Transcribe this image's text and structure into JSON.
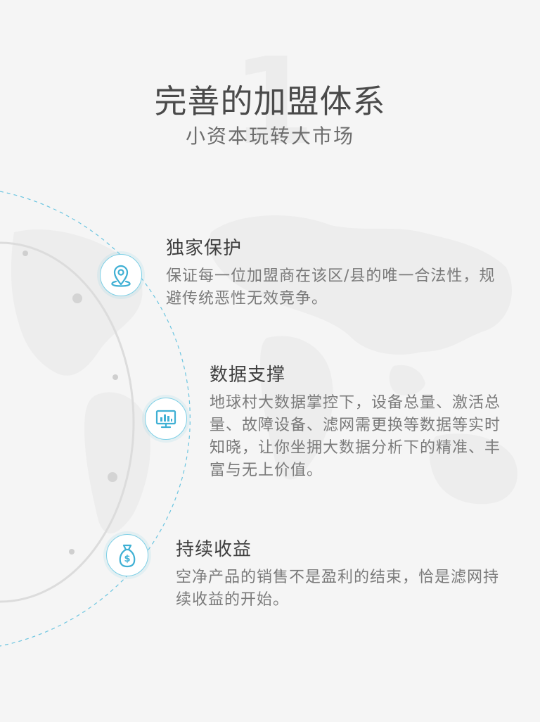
{
  "header": {
    "number": "1",
    "title": "完善的加盟体系",
    "subtitle": "小资本玩转大市场"
  },
  "features": [
    {
      "title": "独家保护",
      "description": "保证每一位加盟商在该区/县的唯一合法性，规避传统恶性无效竞争。",
      "icon": "location-pin-icon"
    },
    {
      "title": "数据支撑",
      "description": "地球村大数据掌控下，设备总量、激活总量、故障设备、滤网需更换等数据等实时知晓，让你坐拥大数据分析下的精准、丰富与无上价值。",
      "icon": "monitor-chart-icon"
    },
    {
      "title": "持续收益",
      "description": "空净产品的销售不是盈利的结束，恰是滤网持续收益的开始。",
      "icon": "money-bag-icon"
    }
  ],
  "colors": {
    "accent": "#3fb0d4",
    "title": "#4a4a4a",
    "text": "#7a7a7a",
    "background": "#f5f5f5"
  }
}
